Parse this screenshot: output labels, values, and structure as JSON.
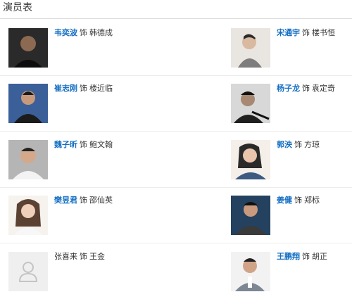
{
  "section_title": "演员表",
  "cast": [
    {
      "actor": "韦奕波",
      "sep": "饰",
      "role": "韩德成",
      "linked": true
    },
    {
      "actor": "宋通宇",
      "sep": "饰",
      "role": "楼书恒",
      "linked": true
    },
    {
      "actor": "崔志刚",
      "sep": "饰",
      "role": "楼近临",
      "linked": true
    },
    {
      "actor": "杨子龙",
      "sep": "饰",
      "role": "袁定奇",
      "linked": true
    },
    {
      "actor": "魏子昕",
      "sep": "饰",
      "role": "鲍文翰",
      "linked": true
    },
    {
      "actor": "郭泱",
      "sep": "饰",
      "role": "方琼",
      "linked": true
    },
    {
      "actor": "樊昱君",
      "sep": "饰",
      "role": "邵仙英",
      "linked": true
    },
    {
      "actor": "姜健",
      "sep": "饰",
      "role": "郑标",
      "linked": true
    },
    {
      "actor": "张喜来",
      "sep": "饰",
      "role": "王金",
      "linked": false
    },
    {
      "actor": "王鹏翔",
      "sep": "饰",
      "role": "胡正",
      "linked": true
    }
  ]
}
